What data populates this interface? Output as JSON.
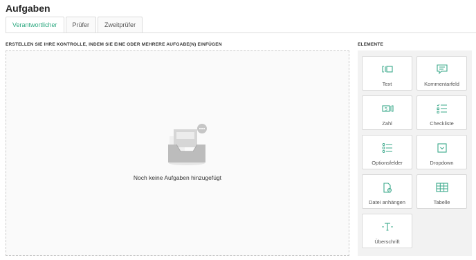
{
  "page": {
    "title": "Aufgaben"
  },
  "tabs": [
    {
      "label": "Verantwortlicher",
      "active": true
    },
    {
      "label": "Prüfer",
      "active": false
    },
    {
      "label": "Zweitprüfer",
      "active": false
    }
  ],
  "dropzone": {
    "heading": "ERSTELLEN SIE IHRE KONTROLLE, INDEM SIE EINE ODER MEHRERE AUFGABE(N) EINFÜGEN",
    "empty_text": "Noch keine Aufgaben hinzugefügt"
  },
  "elements": {
    "heading": "ELEMENTE",
    "items": [
      {
        "label": "Text",
        "icon": "text-field-icon"
      },
      {
        "label": "Kommentarfeld",
        "icon": "comment-icon"
      },
      {
        "label": "Zahl",
        "icon": "number-icon"
      },
      {
        "label": "Checkliste",
        "icon": "checklist-icon"
      },
      {
        "label": "Optionsfelder",
        "icon": "radio-list-icon"
      },
      {
        "label": "Dropdown",
        "icon": "dropdown-icon"
      },
      {
        "label": "Datei anhängen",
        "icon": "attach-file-icon"
      },
      {
        "label": "Tabelle",
        "icon": "table-icon"
      },
      {
        "label": "Überschrift",
        "icon": "heading-icon"
      }
    ]
  },
  "colors": {
    "accent": "#2ea981",
    "icon": "#3aa88a"
  }
}
